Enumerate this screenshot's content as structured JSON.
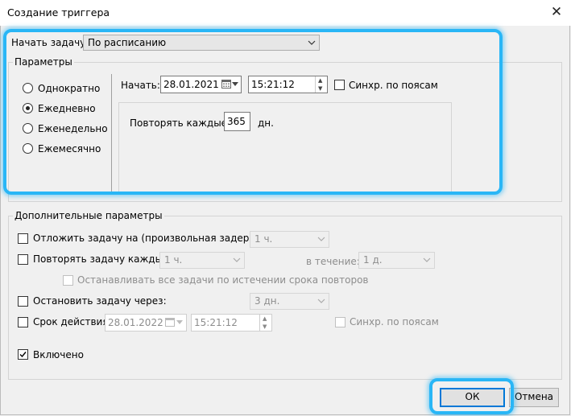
{
  "window": {
    "title": "Создание триггера"
  },
  "begin_task": {
    "label": "Начать задачу:",
    "value": "По расписанию"
  },
  "params": {
    "label": "Параметры",
    "radios": [
      {
        "label": "Однократно",
        "selected": false
      },
      {
        "label": "Ежедневно",
        "selected": true
      },
      {
        "label": "Еженедельно",
        "selected": false
      },
      {
        "label": "Ежемесячно",
        "selected": false
      }
    ],
    "start_label": "Начать:",
    "start_date": "28.01.2021",
    "start_time": "15:21:12",
    "sync_label": "Синхр. по поясам",
    "repeat_every_label": "Повторять каждые:",
    "repeat_every_value": "365",
    "days_unit": "дн."
  },
  "advanced": {
    "label": "Дополнительные параметры",
    "delay_label": "Отложить задачу на (произвольная задержка):",
    "delay_value": "1 ч.",
    "repeat_label": "Повторять задачу каждые:",
    "repeat_value": "1 ч.",
    "duration_label": "в течение:",
    "duration_value": "1 д.",
    "stop_all_label": "Останавливать все задачи по истечении срока повторов",
    "stop_after_label": "Остановить задачу через:",
    "stop_after_value": "3 дн.",
    "expire_label": "Срок действия:",
    "expire_date": "28.01.2022",
    "expire_time": "15:21:12",
    "expire_sync_label": "Синхр. по поясам",
    "enabled_label": "Включено",
    "enabled_checked": true
  },
  "buttons": {
    "ok": "ОК",
    "cancel": "Отмена"
  },
  "colors": {
    "highlight": "#29b6f6",
    "default_button_border": "#0078d7"
  }
}
